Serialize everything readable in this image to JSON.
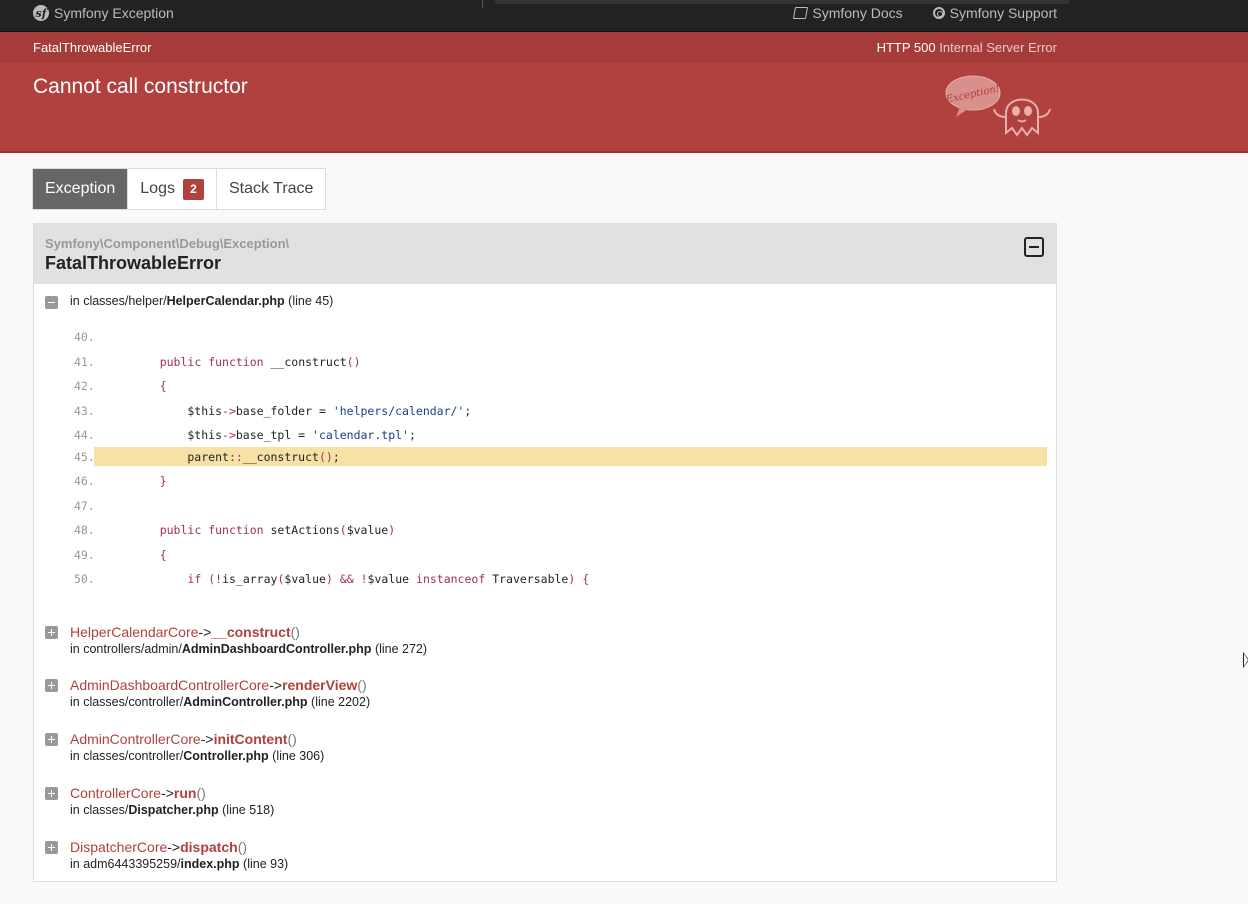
{
  "topbar": {
    "brand": "Symfony Exception",
    "links": [
      "Symfony Docs",
      "Symfony Support"
    ]
  },
  "header": {
    "exception_class": "FatalThrowableError",
    "status_code": "HTTP 500",
    "status_text": "Internal Server Error",
    "message": "Cannot call constructor",
    "mascot_text": "Exception!"
  },
  "tabs": [
    {
      "label": "Exception"
    },
    {
      "label": "Logs",
      "badge": "2"
    },
    {
      "label": "Stack Trace"
    }
  ],
  "panel": {
    "namespace": "Symfony\\Component\\Debug\\Exception\\",
    "exception_name": "FatalThrowableError",
    "location": {
      "prefix": "in classes/helper/",
      "file": "HelperCalendar.php",
      "line": "(line 45)"
    },
    "code": [
      {
        "n": "40.",
        "src": ""
      },
      {
        "n": "41.",
        "src": "    public function __construct()"
      },
      {
        "n": "42.",
        "src": "    {"
      },
      {
        "n": "43.",
        "src": "        $this->base_folder = 'helpers/calendar/';"
      },
      {
        "n": "44.",
        "src": "        $this->base_tpl = 'calendar.tpl';"
      },
      {
        "n": "45.",
        "src": "        parent::__construct();",
        "highlight": true
      },
      {
        "n": "46.",
        "src": "    }"
      },
      {
        "n": "47.",
        "src": ""
      },
      {
        "n": "48.",
        "src": "    public function setActions($value)"
      },
      {
        "n": "49.",
        "src": "    {"
      },
      {
        "n": "50.",
        "src": "        if (!is_array($value) && !$value instanceof Traversable) {"
      }
    ],
    "trace": [
      {
        "cls": "HelperCalendarCore",
        "fn": "__construct",
        "args": "()",
        "path": "in controllers/admin/",
        "file": "AdminDashboardController.php",
        "line": "(line 272)"
      },
      {
        "cls": "AdminDashboardControllerCore",
        "fn": "renderView",
        "args": "()",
        "path": "in classes/controller/",
        "file": "AdminController.php",
        "line": "(line 2202)"
      },
      {
        "cls": "AdminControllerCore",
        "fn": "initContent",
        "args": "()",
        "path": "in classes/controller/",
        "file": "Controller.php",
        "line": "(line 306)"
      },
      {
        "cls": "ControllerCore",
        "fn": "run",
        "args": "()",
        "path": "in classes/",
        "file": "Dispatcher.php",
        "line": "(line 518)"
      },
      {
        "cls": "DispatcherCore",
        "fn": "dispatch",
        "args": "()",
        "path": "in adm6443395259/",
        "file": "index.php",
        "line": "(line 93)"
      }
    ],
    "arrow": "->"
  },
  "colors": {
    "header_red": "#b0413e",
    "header_dark_red": "#a63c3a",
    "highlight_line": "#f8e1a4",
    "topbar": "#222222"
  }
}
